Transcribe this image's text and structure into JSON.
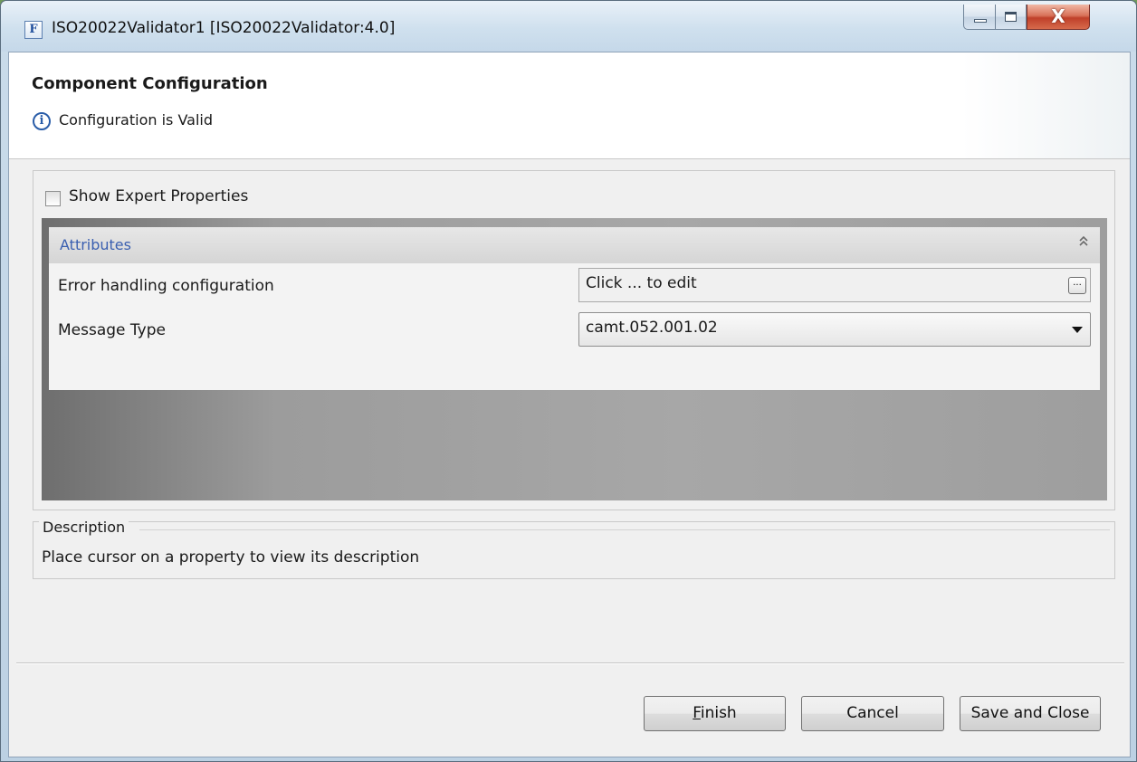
{
  "window": {
    "title": "ISO20022Validator1 [ISO20022Validator:4.0]",
    "app_icon_glyph": "F",
    "controls": {
      "minimize": "minimize-icon",
      "maximize": "maximize-icon",
      "close_glyph": "X"
    }
  },
  "header": {
    "title": "Component Configuration",
    "status_icon": "info-icon",
    "status_text": "Configuration is Valid"
  },
  "options": {
    "show_expert_label": "Show Expert Properties",
    "show_expert_checked": false
  },
  "attributes": {
    "section_title": "Attributes",
    "collapse_icon": "double-chevron-up-icon",
    "rows": [
      {
        "label": "Error handling configuration",
        "value": "Click ... to edit",
        "editor": "ellipsis-button",
        "editor_glyph": "..."
      },
      {
        "label": "Message Type",
        "value": "camt.052.001.02",
        "editor": "dropdown"
      }
    ]
  },
  "description": {
    "legend": "Description",
    "text": "Place cursor on a property to view its description"
  },
  "buttons": {
    "finish_mnemonic": "F",
    "finish_rest": "inish",
    "cancel": "Cancel",
    "save_close": "Save and Close"
  },
  "colors": {
    "accent_link": "#3a5fb0",
    "info_icon": "#2a5da8",
    "close_button": "#c0402a"
  }
}
